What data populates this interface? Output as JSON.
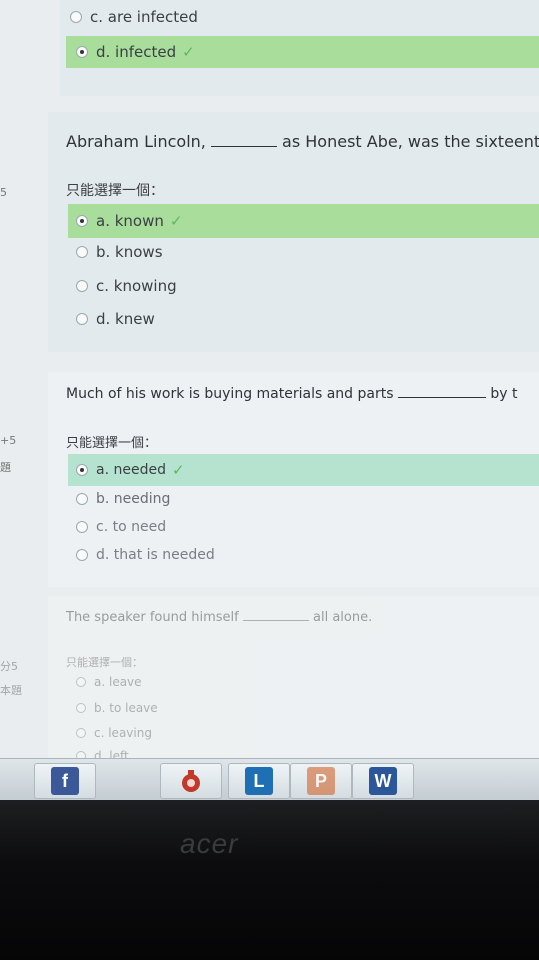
{
  "q_prev": {
    "options": [
      {
        "label": "c. are infected",
        "selected": false,
        "correct": false
      },
      {
        "label": "d. infected",
        "selected": true,
        "correct": true
      }
    ]
  },
  "q1": {
    "side": [
      "5"
    ],
    "text_before": "Abraham Lincoln,",
    "text_after": "as Honest Abe, was the sixteenth",
    "prompt": "只能選擇一個：",
    "options": [
      {
        "label": "a. known",
        "selected": true,
        "correct": true
      },
      {
        "label": "b. knows",
        "selected": false,
        "correct": false
      },
      {
        "label": "c. knowing",
        "selected": false,
        "correct": false
      },
      {
        "label": "d. knew",
        "selected": false,
        "correct": false
      }
    ]
  },
  "q2": {
    "side": [
      "+5",
      "題"
    ],
    "text_before": "Much of his work is buying materials and parts",
    "text_after": "by t",
    "prompt": "只能選擇一個：",
    "options": [
      {
        "label": "a. needed",
        "selected": true,
        "correct": true
      },
      {
        "label": "b. needing",
        "selected": false,
        "correct": false
      },
      {
        "label": "c. to need",
        "selected": false,
        "correct": false
      },
      {
        "label": "d. that is needed",
        "selected": false,
        "correct": false
      }
    ]
  },
  "q3": {
    "side": [
      "分5",
      "本題"
    ],
    "text_before": "The speaker found himself",
    "text_after": "all alone.",
    "prompt": "只能選擇一個：",
    "options": [
      {
        "label": "a. leave",
        "selected": false,
        "correct": false
      },
      {
        "label": "b. to leave",
        "selected": false,
        "correct": false
      },
      {
        "label": "c. leaving",
        "selected": false,
        "correct": false
      },
      {
        "label": "d. left",
        "selected": false,
        "correct": false
      }
    ]
  },
  "taskbar": {
    "apps": [
      {
        "icon": "facebook-icon",
        "letter": "f",
        "color": "#3b5998"
      },
      {
        "icon": "app-icon",
        "letter": "",
        "color": "#c0392b"
      },
      {
        "icon": "lync-icon",
        "letter": "L",
        "color": "#1f6fb5"
      },
      {
        "icon": "powerpoint-icon",
        "letter": "P",
        "color": "#d1652a"
      },
      {
        "icon": "word-icon",
        "letter": "W",
        "color": "#2b579a"
      }
    ]
  },
  "brand": "acer"
}
